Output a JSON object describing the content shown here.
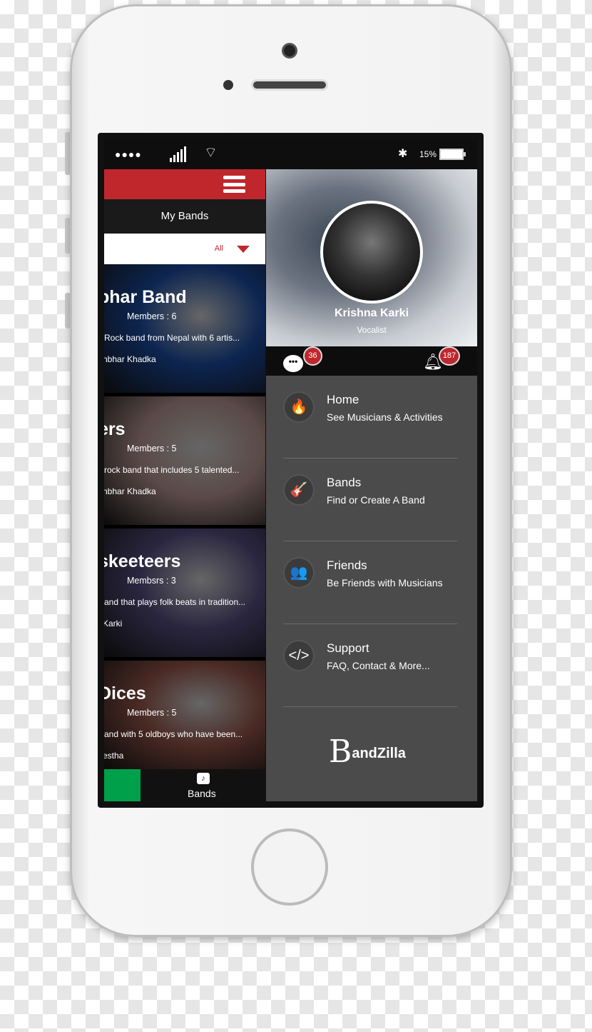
{
  "status": {
    "signal_dots": "●●●●",
    "battery": "15%",
    "battery_level": 0.15
  },
  "left": {
    "title": "My Bands",
    "filter": {
      "selected": "All"
    },
    "bands": [
      {
        "name": "bhar Band",
        "members": "Members : 6",
        "desc": "Rock band from Nepal with 6 artis...",
        "owner": "nbhar Khadka",
        "bg": "#0d2550"
      },
      {
        "name": "ers",
        "members": "Members : 5",
        "desc": "rock band that includes 5 talented...",
        "owner": "nbhar Khadka",
        "bg": "#5a4a48"
      },
      {
        "name": "skeeteers",
        "members": "Membsrs : 3",
        "desc": "and that plays folk beats in tradition...",
        "owner": "Karki",
        "bg": "#2b2640"
      },
      {
        "name": "Dices",
        "members": "Members : 5",
        "desc": "and with 5 oldboys who have been...",
        "owner": "estha",
        "bg": "#4a2a24"
      }
    ],
    "nav": {
      "bands_label": "Bands"
    }
  },
  "profile": {
    "name": "Krishna Karki",
    "role": "Vocalist",
    "messages": "36",
    "notifications": "187"
  },
  "menu": [
    {
      "title": "Home",
      "subtitle": "See Musicians & Activities",
      "icon": "flame-icon",
      "glyph": "🔥"
    },
    {
      "title": "Bands",
      "subtitle": "Find or Create A Band",
      "icon": "guitar-icon",
      "glyph": "🎸"
    },
    {
      "title": "Friends",
      "subtitle": "Be Friends with Musicians",
      "icon": "friends-icon",
      "glyph": "👥"
    },
    {
      "title": "Support",
      "subtitle": "FAQ, Contact & More...",
      "icon": "code-icon",
      "glyph": "</>"
    }
  ],
  "logo": {
    "b": "B",
    "rest": "andZilla"
  },
  "colors": {
    "accent": "#c0272d",
    "green": "#00a04a",
    "menu_bg": "#4b4b4b"
  }
}
